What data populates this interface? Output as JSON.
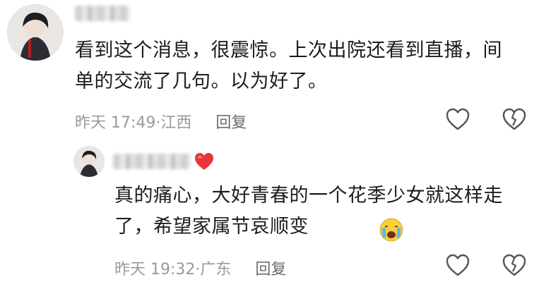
{
  "top_comment": {
    "avatar": "avatar",
    "text": "看到这个消息，很震惊。上次出院还看到直播，间单的交流了几句。以为好了。",
    "time": "昨天 17:49",
    "location": "江西",
    "reply_label": "回复",
    "like_icon": "heart-outline-icon",
    "dislike_icon": "broken-heart-icon"
  },
  "reply_comment": {
    "avatar": "avatar",
    "badge_icon": "red-heart-icon",
    "text": "真的痛心，大好青春的一个花季少女就这样走了，希望家属节哀顺变",
    "emoji": "crying-face-emoji",
    "time": "昨天 19:32",
    "location": "广东",
    "reply_label": "回复",
    "like_icon": "heart-outline-icon",
    "dislike_icon": "broken-heart-icon"
  },
  "colors": {
    "meta_text": "#9a9a9a",
    "reply_text": "#6d6d6d",
    "heart_badge": "#e8363b"
  }
}
